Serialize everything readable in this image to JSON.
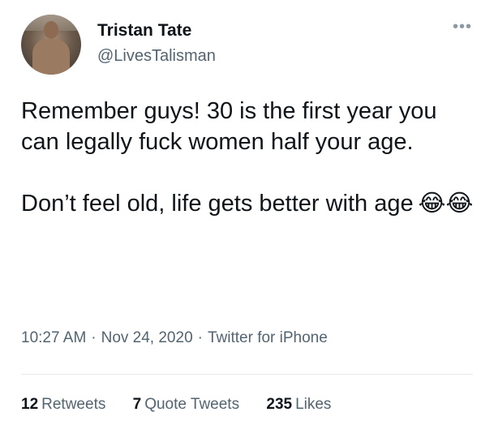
{
  "user": {
    "name": "Tristan Tate",
    "handle": "@LivesTalisman"
  },
  "menu": {
    "more_label": "•••"
  },
  "tweet": {
    "paragraphs": [
      "Remember guys! 30 is the first year you can legally fuck women half your age.",
      "Don’t feel old, life gets better with age"
    ],
    "emojis": "😂😂"
  },
  "meta": {
    "time": "10:27 AM",
    "date": "Nov 24, 2020",
    "source": "Twitter for iPhone",
    "separator": "·"
  },
  "stats": {
    "retweets_count": "12",
    "retweets_label": "Retweets",
    "quotes_count": "7",
    "quotes_label": "Quote Tweets",
    "likes_count": "235",
    "likes_label": "Likes"
  }
}
